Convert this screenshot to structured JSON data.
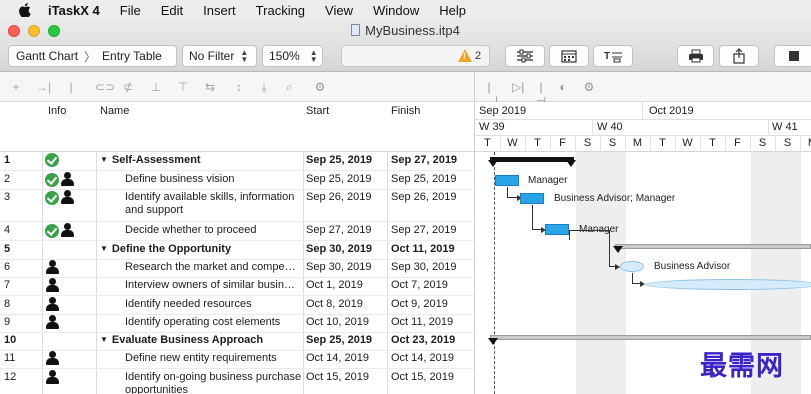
{
  "menubar": {
    "app": "iTaskX 4",
    "items": [
      "File",
      "Edit",
      "Insert",
      "Tracking",
      "View",
      "Window",
      "Help"
    ]
  },
  "window": {
    "title": "MyBusiness.itp4"
  },
  "toolbar": {
    "view": "Gantt Chart",
    "subview": "Entry Table",
    "filter": "No Filter",
    "zoom": "150%",
    "warning_count": "2"
  },
  "table": {
    "headers": {
      "info": "Info",
      "name": "Name",
      "start": "Start",
      "finish": "Finish"
    },
    "rows": [
      {
        "id": "1",
        "name": "Self-Assessment",
        "start": "Sep 25, 2019",
        "finish": "Sep 27, 2019",
        "summary": true,
        "info": [
          "check"
        ]
      },
      {
        "id": "2",
        "name": "Define business vision",
        "start": "Sep 25, 2019",
        "finish": "Sep 25, 2019",
        "summary": false,
        "info": [
          "check",
          "person"
        ]
      },
      {
        "id": "3",
        "name": "Identify available skills, information and support",
        "start": "Sep 26, 2019",
        "finish": "Sep 26, 2019",
        "summary": false,
        "info": [
          "check",
          "person"
        ]
      },
      {
        "id": "4",
        "name": "Decide whether to proceed",
        "start": "Sep 27, 2019",
        "finish": "Sep 27, 2019",
        "summary": false,
        "info": [
          "check",
          "person"
        ]
      },
      {
        "id": "5",
        "name": "Define the Opportunity",
        "start": "Sep 30, 2019",
        "finish": "Oct 11, 2019",
        "summary": true,
        "info": []
      },
      {
        "id": "6",
        "name": "Research the market and compe…",
        "start": "Sep 30, 2019",
        "finish": "Sep 30, 2019",
        "summary": false,
        "info": [
          "person"
        ]
      },
      {
        "id": "7",
        "name": "Interview owners of similar busin…",
        "start": "Oct 1, 2019",
        "finish": "Oct 7, 2019",
        "summary": false,
        "info": [
          "person"
        ]
      },
      {
        "id": "8",
        "name": "Identify needed resources",
        "start": "Oct 8, 2019",
        "finish": "Oct 9, 2019",
        "summary": false,
        "info": [
          "person"
        ]
      },
      {
        "id": "9",
        "name": "Identify operating cost elements",
        "start": "Oct 10, 2019",
        "finish": "Oct 11, 2019",
        "summary": false,
        "info": [
          "person"
        ]
      },
      {
        "id": "10",
        "name": "Evaluate Business Approach",
        "start": "Sep 25, 2019",
        "finish": "Oct 23, 2019",
        "summary": true,
        "info": []
      },
      {
        "id": "11",
        "name": "Define new entity requirements",
        "start": "Oct 14, 2019",
        "finish": "Oct 14, 2019",
        "summary": false,
        "info": [
          "person"
        ]
      },
      {
        "id": "12",
        "name": "Identify on-going business purchase opportunities",
        "start": "Oct 15, 2019",
        "finish": "Oct 15, 2019",
        "summary": false,
        "info": [
          "person"
        ]
      }
    ]
  },
  "gantt": {
    "months": [
      "Sep 2019",
      "Oct 2019"
    ],
    "weeks": [
      "W 39",
      "W 40",
      "W 41"
    ],
    "days": [
      "T",
      "W",
      "T",
      "F",
      "S",
      "S",
      "M",
      "T",
      "W",
      "T",
      "F",
      "S",
      "S",
      "M"
    ],
    "labels": {
      "task2": "Manager",
      "task3": "Business Advisor; Manager",
      "task4": "Manager",
      "task6": "Business Advisor"
    }
  },
  "watermark": "最需网"
}
